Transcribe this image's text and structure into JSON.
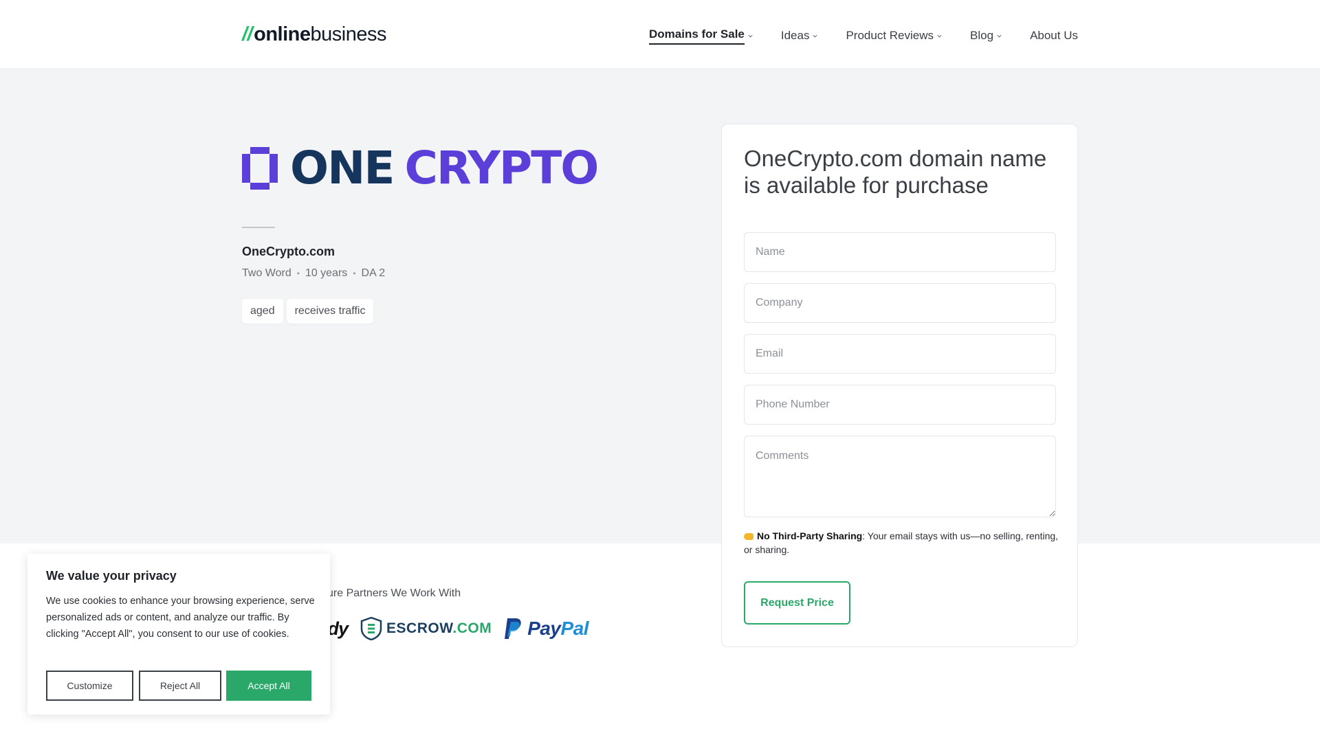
{
  "header": {
    "logo": {
      "slashes": "//",
      "part1": "online",
      "part2": "business"
    },
    "nav": [
      {
        "label": "Domains for Sale",
        "has_dropdown": true,
        "active": true
      },
      {
        "label": "Ideas",
        "has_dropdown": true,
        "active": false
      },
      {
        "label": "Product Reviews",
        "has_dropdown": true,
        "active": false
      },
      {
        "label": "Blog",
        "has_dropdown": true,
        "active": false
      },
      {
        "label": "About Us",
        "has_dropdown": false,
        "active": false
      }
    ]
  },
  "domain": {
    "logo_word1": "ONE",
    "logo_word2": "CRYPTO",
    "name": "OneCrypto.com",
    "meta": [
      "Two Word",
      "10 years",
      "DA 2"
    ],
    "tags": [
      "aged",
      "receives traffic"
    ]
  },
  "partners": {
    "label": "ure Partners We Work With",
    "godaddy_fragment": "ldy",
    "escrow": {
      "name": "ESCROW",
      "suffix": ".COM"
    },
    "paypal": {
      "pay": "Pay",
      "pal": "Pal"
    }
  },
  "form": {
    "title": "OneCrypto.com domain name is available for purchase",
    "fields": {
      "name_placeholder": "Name",
      "company_placeholder": "Company",
      "email_placeholder": "Email",
      "phone_placeholder": "Phone Number",
      "comments_placeholder": "Comments"
    },
    "privacy_bold": "No Third-Party Sharing",
    "privacy_text": ": Your email stays with us—no selling, renting, or sharing.",
    "submit_label": "Request Price"
  },
  "cookie": {
    "title": "We value your privacy",
    "text": "We use cookies to enhance your browsing experience, serve personalized ads or content, and analyze our traffic. By clicking \"Accept All\", you consent to our use of cookies.",
    "customize_label": "Customize",
    "reject_label": "Reject All",
    "accept_label": "Accept All"
  },
  "colors": {
    "accent_green": "#2aa86a",
    "logo_navy": "#16355c",
    "logo_purple": "#5b3fd8",
    "hero_bg": "#f3f4f5"
  }
}
